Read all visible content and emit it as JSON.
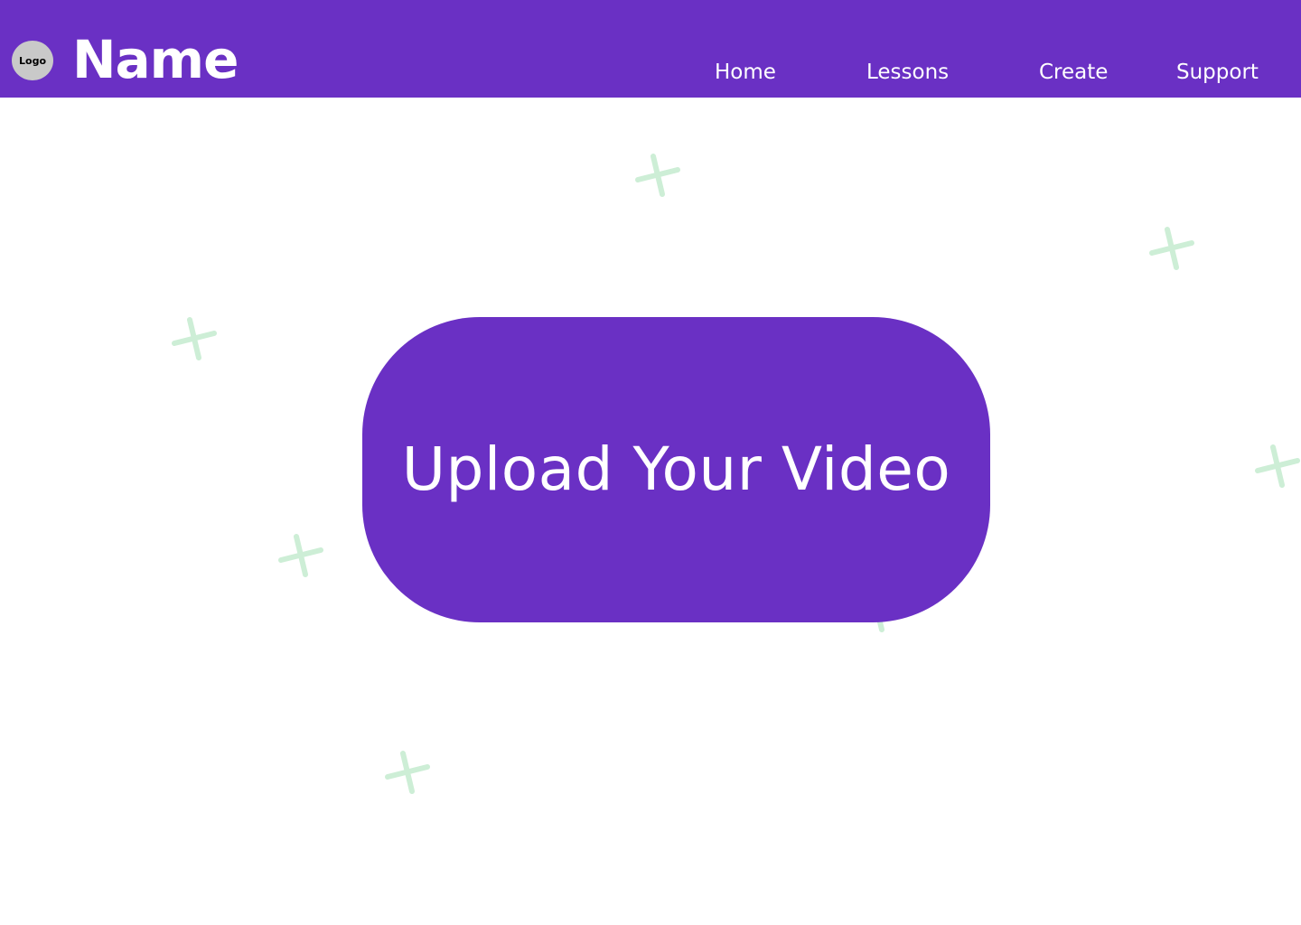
{
  "header": {
    "logo_label": "Logo",
    "brand_name": "Name",
    "nav": [
      {
        "label": "Home"
      },
      {
        "label": "Lessons"
      },
      {
        "label": "Create"
      },
      {
        "label": "Support"
      }
    ]
  },
  "main": {
    "upload_button_label": "Upload Your Video"
  },
  "decorations": {
    "icon": "sparkle-cross-icon",
    "count": 7
  },
  "colors": {
    "primary": "#6a30c4",
    "text_on_primary": "#ffffff",
    "logo_bg": "#c9c9c9",
    "decoration": "#cdeed6",
    "background": "#ffffff"
  }
}
